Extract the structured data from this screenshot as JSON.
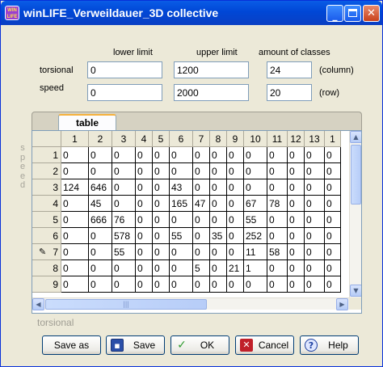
{
  "window": {
    "title": "winLIFE_Verweildauer_3D collective",
    "icon_text": "WIN LIFE",
    "min_glyph": "_",
    "close_glyph": "✕"
  },
  "limits": {
    "lower_header": "lower limit",
    "upper_header": "upper limit",
    "classes_header": "amount of classes",
    "torsional": {
      "label": "torsional",
      "lower": "0",
      "upper": "1200",
      "classes": "24",
      "unit": "(column)"
    },
    "speed": {
      "label": "speed",
      "lower": "0",
      "upper": "2000",
      "classes": "20",
      "unit": "(row)"
    }
  },
  "table": {
    "tab_label": "table",
    "vertical_label": "speed",
    "bottom_label": "torsional",
    "column_headers": [
      "1",
      "2",
      "3",
      "4",
      "5",
      "6",
      "7",
      "8",
      "9",
      "10",
      "11",
      "12",
      "13",
      "1"
    ],
    "row_headers": [
      "1",
      "2",
      "3",
      "4",
      "5",
      "6",
      "7",
      "8",
      "9"
    ],
    "edit_row_marker": "✎",
    "rows": [
      [
        "0",
        "0",
        "0",
        "0",
        "0",
        "0",
        "0",
        "0",
        "0",
        "0",
        "0",
        "0",
        "0",
        "0"
      ],
      [
        "0",
        "0",
        "0",
        "0",
        "0",
        "0",
        "0",
        "0",
        "0",
        "0",
        "0",
        "0",
        "0",
        "0"
      ],
      [
        "124",
        "646",
        "0",
        "0",
        "0",
        "43",
        "0",
        "0",
        "0",
        "0",
        "0",
        "0",
        "0",
        "0"
      ],
      [
        "0",
        "45",
        "0",
        "0",
        "0",
        "165",
        "47",
        "0",
        "0",
        "67",
        "78",
        "0",
        "0",
        "0"
      ],
      [
        "0",
        "666",
        "76",
        "0",
        "0",
        "0",
        "0",
        "0",
        "0",
        "55",
        "0",
        "0",
        "0",
        "0"
      ],
      [
        "0",
        "0",
        "578",
        "0",
        "0",
        "55",
        "0",
        "35",
        "0",
        "252",
        "0",
        "0",
        "0",
        "0"
      ],
      [
        "0",
        "0",
        "55",
        "0",
        "0",
        "0",
        "0",
        "0",
        "0",
        "11",
        "58",
        "0",
        "0",
        "0"
      ],
      [
        "0",
        "0",
        "0",
        "0",
        "0",
        "0",
        "5",
        "0",
        "21",
        "1",
        "0",
        "0",
        "0",
        "0"
      ],
      [
        "0",
        "0",
        "0",
        "0",
        "0",
        "0",
        "0",
        "0",
        "0",
        "0",
        "0",
        "0",
        "0",
        "0"
      ]
    ]
  },
  "scroll_glyphs": {
    "up": "▲",
    "down": "▼",
    "left": "◀",
    "right": "▶",
    "grip": "|||"
  },
  "buttons": {
    "save_as": "Save as",
    "save": "Save",
    "ok": "OK",
    "cancel": "Cancel",
    "help": "Help",
    "ok_icon": "✓",
    "cancel_icon": "✕",
    "help_icon": "?",
    "save_icon": "▪"
  },
  "colors": {
    "titlebar": "#0047d6",
    "window_bg": "#ece9d8",
    "tab_highlight": "#f5b13d"
  }
}
